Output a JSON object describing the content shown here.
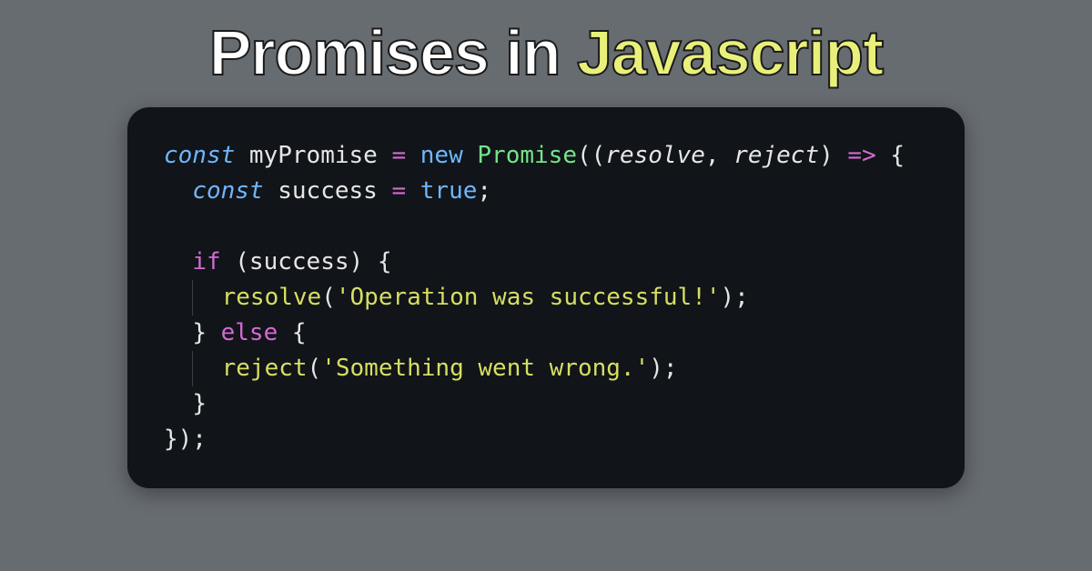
{
  "title": {
    "part1": "Promises in ",
    "part2": "Javascript"
  },
  "colors": {
    "background": "#676c71",
    "card_bg": "#111418",
    "title_text": "#ffffff",
    "title_accent": "#e9f07a",
    "kw_const": "#6fb6ff",
    "kw_ctrl": "#d26bd2",
    "classname": "#77e38b",
    "string": "#d7de62",
    "function": "#d7de62",
    "operator": "#d26bd2",
    "default": "#e6e6e6"
  },
  "code": {
    "lines": [
      {
        "indent": 0,
        "tokens": [
          {
            "t": "const ",
            "c": "kw-const"
          },
          {
            "t": "myPromise ",
            "c": "ident"
          },
          {
            "t": "= ",
            "c": "op"
          },
          {
            "t": "new ",
            "c": "kw-new"
          },
          {
            "t": "Promise",
            "c": "classname"
          },
          {
            "t": "((",
            "c": "punct"
          },
          {
            "t": "resolve",
            "c": "param"
          },
          {
            "t": ", ",
            "c": "punct"
          },
          {
            "t": "reject",
            "c": "param"
          },
          {
            "t": ") ",
            "c": "punct"
          },
          {
            "t": "=>",
            "c": "op"
          },
          {
            "t": " {",
            "c": "punct"
          }
        ]
      },
      {
        "indent": 1,
        "tokens": [
          {
            "t": "const ",
            "c": "kw-const"
          },
          {
            "t": "success ",
            "c": "ident"
          },
          {
            "t": "= ",
            "c": "op"
          },
          {
            "t": "true",
            "c": "lit-bool"
          },
          {
            "t": ";",
            "c": "punct"
          }
        ]
      },
      {
        "indent": 0,
        "tokens": [
          {
            "t": " ",
            "c": "punct"
          }
        ]
      },
      {
        "indent": 1,
        "tokens": [
          {
            "t": "if ",
            "c": "kw-ctrl"
          },
          {
            "t": "(success) {",
            "c": "punct"
          }
        ]
      },
      {
        "indent": 2,
        "guide": true,
        "tokens": [
          {
            "t": "resolve",
            "c": "fn"
          },
          {
            "t": "(",
            "c": "punct"
          },
          {
            "t": "'Operation was successful!'",
            "c": "str"
          },
          {
            "t": ");",
            "c": "punct"
          }
        ]
      },
      {
        "indent": 1,
        "tokens": [
          {
            "t": "} ",
            "c": "punct"
          },
          {
            "t": "else ",
            "c": "kw-ctrl"
          },
          {
            "t": "{",
            "c": "punct"
          }
        ]
      },
      {
        "indent": 2,
        "guide": true,
        "tokens": [
          {
            "t": "reject",
            "c": "fn"
          },
          {
            "t": "(",
            "c": "punct"
          },
          {
            "t": "'Something went wrong.'",
            "c": "str"
          },
          {
            "t": ");",
            "c": "punct"
          }
        ]
      },
      {
        "indent": 1,
        "tokens": [
          {
            "t": "}",
            "c": "punct"
          }
        ]
      },
      {
        "indent": 0,
        "tokens": [
          {
            "t": "});",
            "c": "punct"
          }
        ]
      }
    ],
    "indent_unit": "  "
  }
}
